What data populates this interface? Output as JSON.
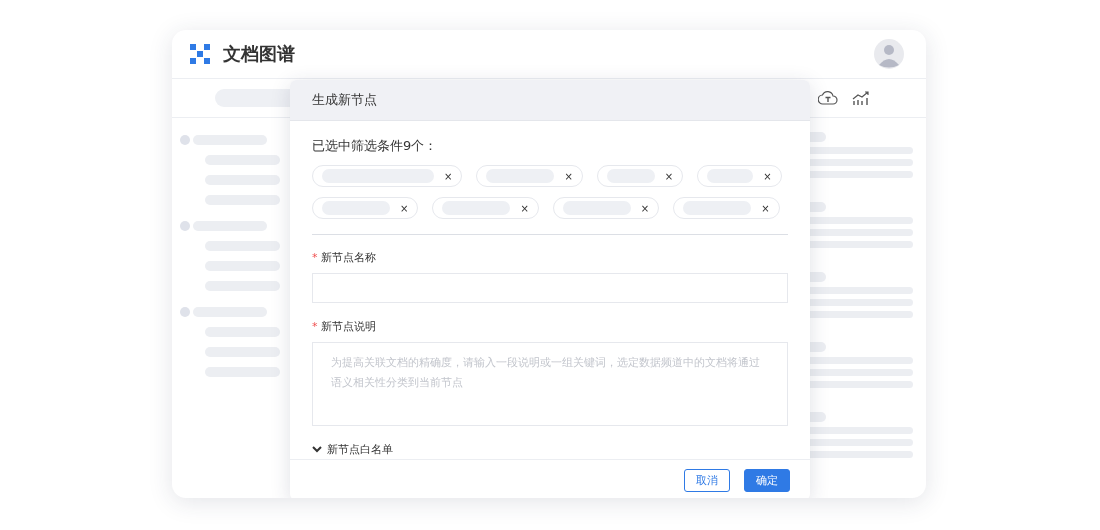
{
  "app": {
    "title": "文档图谱"
  },
  "dialog": {
    "title": "生成新节点",
    "filter_summary": "已选中筛选条件9个：",
    "chips": [
      {
        "remove": "×"
      },
      {
        "remove": "×"
      },
      {
        "remove": "×"
      },
      {
        "remove": "×"
      },
      {
        "remove": "×"
      },
      {
        "remove": "×"
      },
      {
        "remove": "×"
      },
      {
        "remove": "×"
      }
    ],
    "fields": [
      {
        "kind": "input",
        "label": "新节点名称",
        "required_mark": "*"
      },
      {
        "kind": "textarea",
        "label": "新节点说明",
        "required_mark": "*",
        "placeholder": "为提高关联文档的精确度，请输入一段说明或一组关键词，选定数据频道中的文档将通过语义相关性分类到当前节点"
      }
    ],
    "whitelist": {
      "label": "新节点白名单",
      "expanded": false
    },
    "buttons": [
      {
        "kind": "secondary",
        "label": "取消"
      },
      {
        "kind": "primary",
        "label": "确定"
      }
    ]
  }
}
